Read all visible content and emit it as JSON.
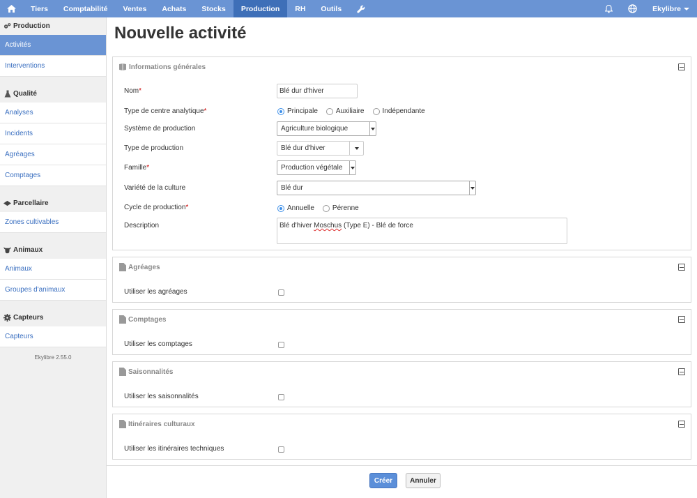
{
  "nav": {
    "home_icon": "home-icon",
    "items": [
      {
        "label": "Tiers"
      },
      {
        "label": "Comptabilité"
      },
      {
        "label": "Ventes"
      },
      {
        "label": "Achats"
      },
      {
        "label": "Stocks"
      },
      {
        "label": "Production",
        "active": true
      },
      {
        "label": "RH"
      },
      {
        "label": "Outils"
      }
    ],
    "wrench_icon": "wrench-icon",
    "bell_icon": "bell-icon",
    "globe_icon": "globe-icon",
    "user_label": "Ekylibre"
  },
  "sidebar": {
    "sections": [
      {
        "title": "Production",
        "icon": "gears-icon",
        "items": [
          {
            "label": "Activités",
            "active": true
          },
          {
            "label": "Interventions"
          }
        ]
      },
      {
        "title": "Qualité",
        "icon": "flask-icon",
        "items": [
          {
            "label": "Analyses"
          },
          {
            "label": "Incidents"
          },
          {
            "label": "Agréages"
          },
          {
            "label": "Comptages"
          }
        ]
      },
      {
        "title": "Parcellaire",
        "icon": "parcel-icon",
        "items": [
          {
            "label": "Zones cultivables"
          }
        ]
      },
      {
        "title": "Animaux",
        "icon": "cow-icon",
        "items": [
          {
            "label": "Animaux"
          },
          {
            "label": "Groupes d'animaux"
          }
        ]
      },
      {
        "title": "Capteurs",
        "icon": "gear-icon",
        "items": [
          {
            "label": "Capteurs"
          }
        ]
      }
    ],
    "version": "Ekylibre 2.55.0"
  },
  "page": {
    "title": "Nouvelle activité"
  },
  "general": {
    "title": "Informations générales",
    "name_label": "Nom",
    "name_value": "Blé dur d'hiver",
    "center_type_label": "Type de centre analytique",
    "center_options": [
      "Principale",
      "Auxiliaire",
      "Indépendante"
    ],
    "center_selected": "Principale",
    "production_system_label": "Système de production",
    "production_system_value": "Agriculture biologique",
    "production_type_label": "Type de production",
    "production_type_value": "Blé dur d'hiver",
    "family_label": "Famille",
    "family_value": "Production végétale",
    "variety_label": "Variété de la culture",
    "variety_value": "Blé dur",
    "cycle_label": "Cycle de production",
    "cycle_options": [
      "Annuelle",
      "Pérenne"
    ],
    "cycle_selected": "Annuelle",
    "description_label": "Description",
    "description_pre": "Blé d'hiver ",
    "description_word": "Moschus",
    "description_post": " (Type E) - Blé de force",
    "required_mark": "*"
  },
  "agreages": {
    "title": "Agréages",
    "checkbox_label": "Utiliser les agréages",
    "checked": false
  },
  "comptages": {
    "title": "Comptages",
    "checkbox_label": "Utiliser les comptages",
    "checked": false
  },
  "saisonnalites": {
    "title": "Saisonnalités",
    "checkbox_label": "Utiliser les saisonnalités",
    "checked": false
  },
  "itineraires": {
    "title": "Itinéraires culturaux",
    "checkbox_label": "Utiliser les itinéraires techniques",
    "checked": false
  },
  "actions": {
    "create_label": "Créer",
    "cancel_label": "Annuler"
  },
  "colors": {
    "nav_bg": "#6a94d4",
    "nav_active": "#3e6fb8",
    "link": "#3a6fc0",
    "primary_button": "#5b8fd9"
  }
}
